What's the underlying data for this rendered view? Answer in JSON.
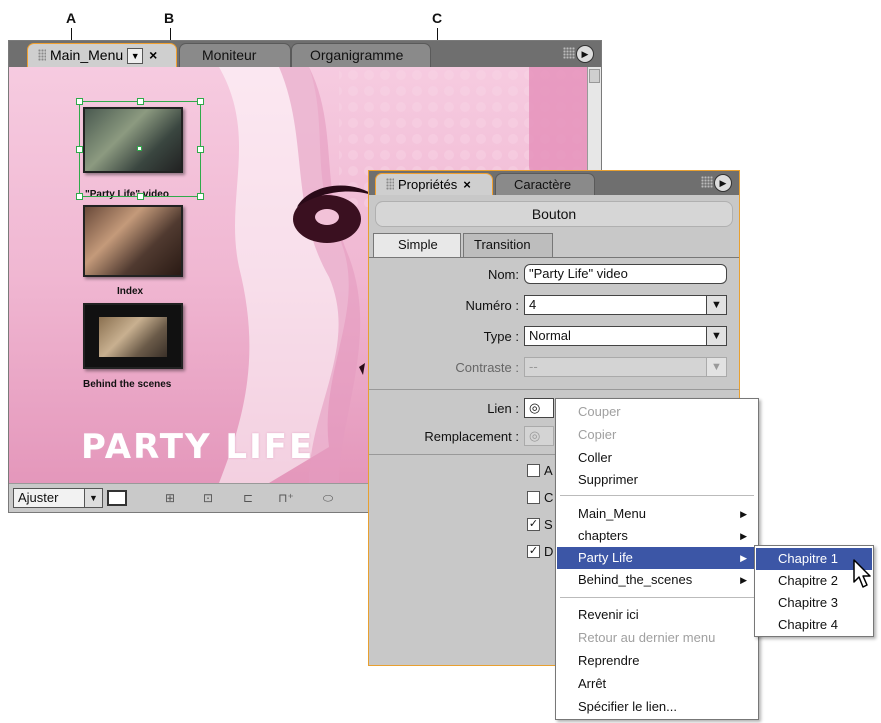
{
  "callouts": {
    "a": "A",
    "b": "B",
    "c": "C"
  },
  "main_panel": {
    "tabs": [
      {
        "label": "Main_Menu",
        "active": true
      },
      {
        "label": "Moniteur",
        "active": false
      },
      {
        "label": "Organigramme",
        "active": false
      }
    ],
    "close_glyph": "×",
    "dropdown_glyph": "▼",
    "menu_icon": "panel-menu-icon",
    "thumbnails": [
      {
        "caption": "\"Party Life\" video",
        "selected": true
      },
      {
        "caption": "Index",
        "selected": false
      },
      {
        "caption": "Behind the scenes",
        "selected": false
      }
    ],
    "logo_text": "PARTY LIFE",
    "toolbar": {
      "zoom_label": "Ajuster",
      "zoom_arrow": "▼",
      "tools": [
        "safe-area-icon",
        "button-routing-icon",
        "grid-icon",
        "align-icon",
        "add-guide-icon",
        "toggle-icon"
      ]
    }
  },
  "properties_panel": {
    "tabs": [
      {
        "label": "Propriétés",
        "active": true
      },
      {
        "label": "Caractère",
        "active": false
      }
    ],
    "close_glyph": "×",
    "header": "Bouton",
    "subtabs": [
      {
        "label": "Simple",
        "active": true
      },
      {
        "label": "Transition",
        "active": false
      }
    ],
    "fields": {
      "nom": {
        "label": "Nom:",
        "value": "\"Party Life\" video"
      },
      "numero": {
        "label": "Numéro :",
        "value": "4"
      },
      "type": {
        "label": "Type :",
        "value": "Normal"
      },
      "contraste": {
        "label": "Contraste :",
        "value": "--"
      },
      "lien": {
        "label": "Lien :"
      },
      "remplacement": {
        "label": "Remplacement :"
      }
    },
    "checkboxes": [
      {
        "partial_label": "A",
        "checked": false
      },
      {
        "partial_label": "C",
        "checked": false
      },
      {
        "partial_label": "S",
        "checked": true
      },
      {
        "partial_label": "D",
        "checked": true
      }
    ]
  },
  "context_menu": {
    "items": [
      {
        "label": "Couper",
        "disabled": true
      },
      {
        "label": "Copier",
        "disabled": true
      },
      {
        "label": "Coller",
        "disabled": false
      },
      {
        "label": "Supprimer",
        "disabled": false
      },
      {
        "label": "Main_Menu",
        "submenu": true
      },
      {
        "label": "chapters",
        "submenu": true
      },
      {
        "label": "Party Life",
        "submenu": true,
        "highlight": true
      },
      {
        "label": "Behind_the_scenes",
        "submenu": true
      },
      {
        "label": "Revenir ici",
        "disabled": false
      },
      {
        "label": "Retour au dernier menu",
        "disabled": true
      },
      {
        "label": "Reprendre",
        "disabled": false
      },
      {
        "label": "Arrêt",
        "disabled": false
      },
      {
        "label": "Spécifier le lien...",
        "disabled": false
      }
    ],
    "submenu": [
      {
        "label": "Chapitre 1",
        "highlight": true
      },
      {
        "label": "Chapitre 2"
      },
      {
        "label": "Chapitre 3"
      },
      {
        "label": "Chapitre 4"
      }
    ]
  },
  "colors": {
    "menu_highlight": "#3c56a6",
    "panel_border_active": "#e8a030",
    "selection_green": "#2faa4a",
    "canvas_pink": "#f0b7d2"
  }
}
